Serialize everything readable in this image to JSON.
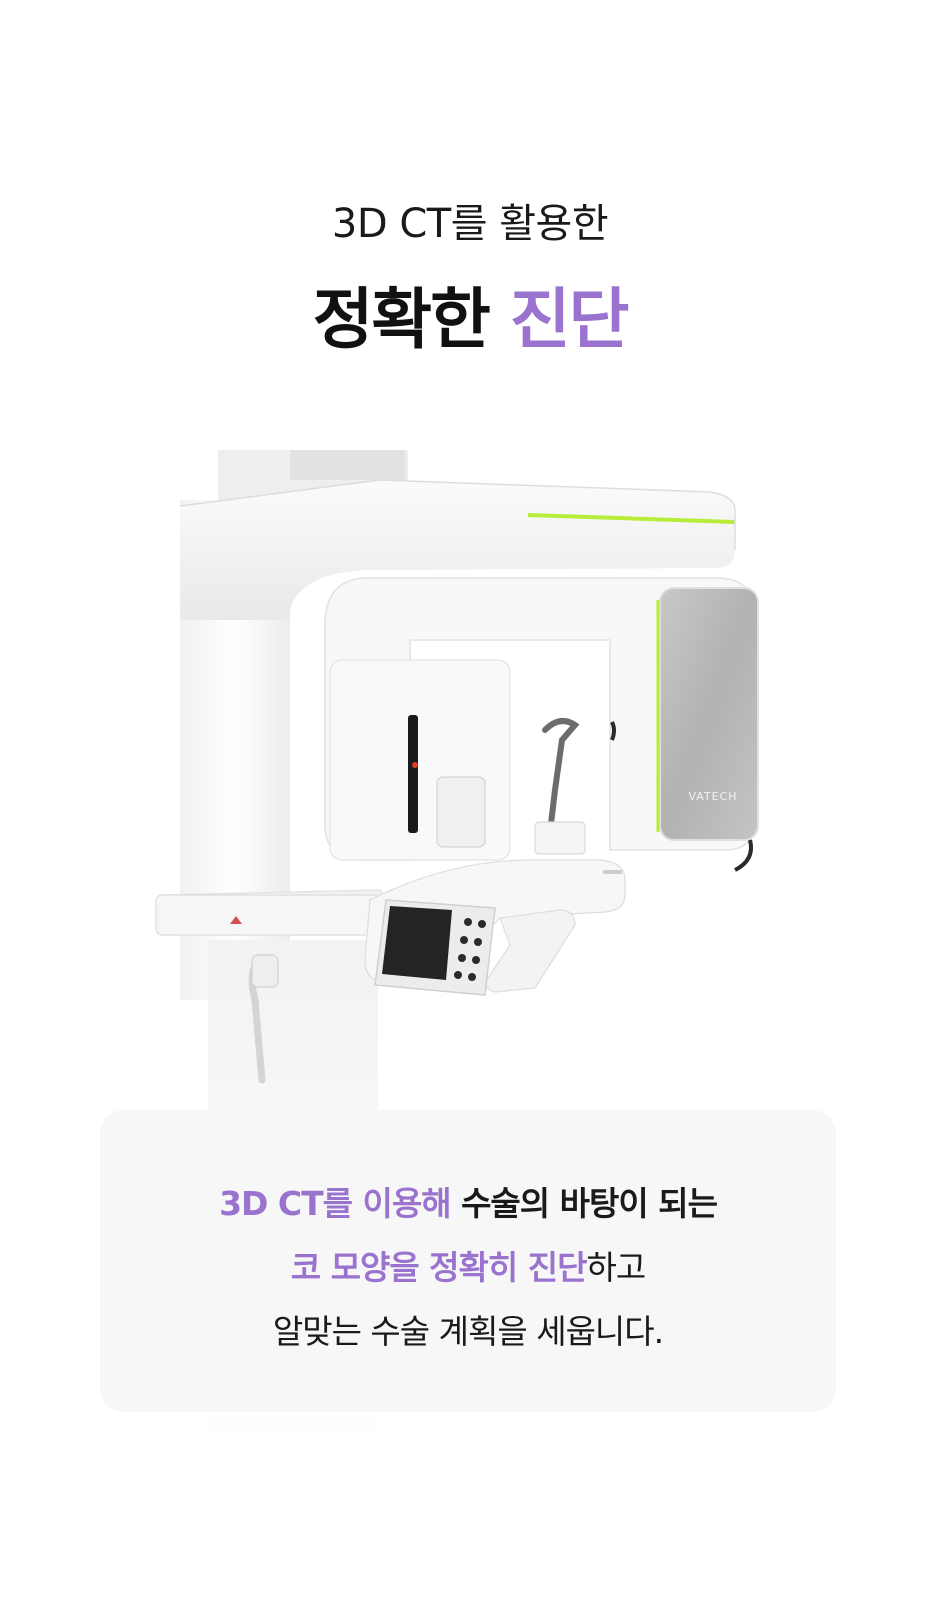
{
  "heading": {
    "subtitle": "3D CT를 활용한",
    "title_main": "정확한 ",
    "title_accent": "진단"
  },
  "device": {
    "brand_label": "VATECH"
  },
  "info": {
    "line1_accent": "3D CT를 이용해",
    "line1_bold": " 수술의 바탕이 되는",
    "line2_accent": "코 모양을 정확히 진단",
    "line2_rest": "하고",
    "line3": "알맞는 수술 계획을 세웁니다."
  },
  "colors": {
    "accent": "#9a73cf",
    "text": "#1a1a1a",
    "card_bg": "#f7f7f7",
    "device_accent_line": "#b8ec3a"
  }
}
